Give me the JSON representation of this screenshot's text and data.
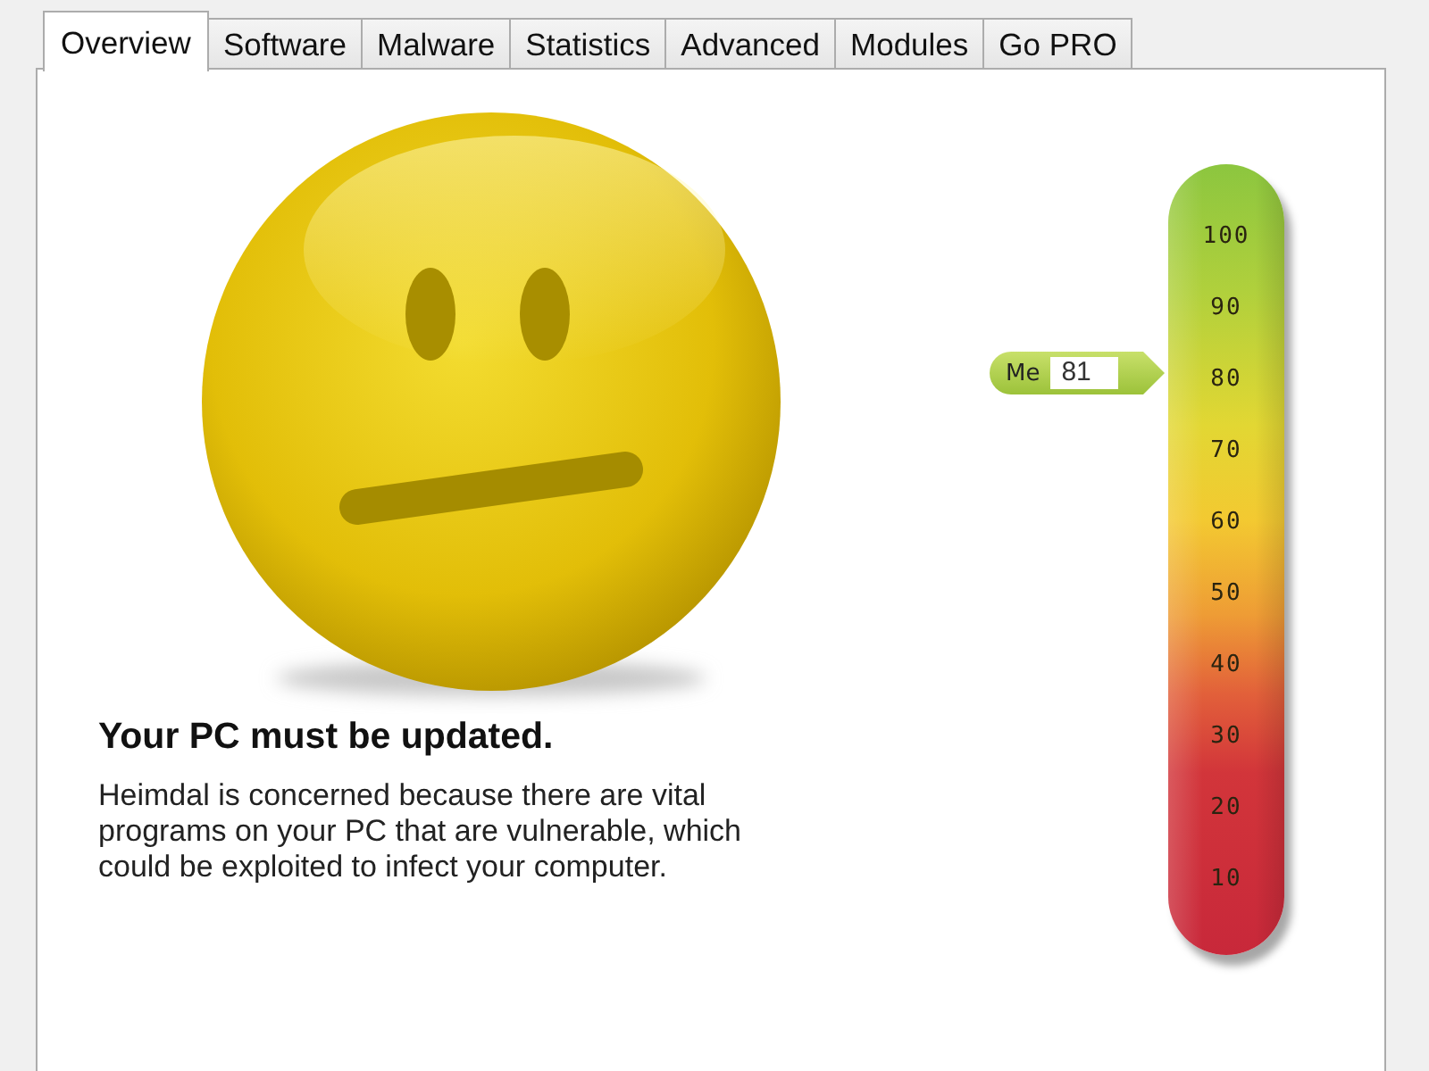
{
  "tabs": [
    {
      "label": "Overview",
      "selected": true
    },
    {
      "label": "Software",
      "selected": false
    },
    {
      "label": "Malware",
      "selected": false
    },
    {
      "label": "Statistics",
      "selected": false
    },
    {
      "label": "Advanced",
      "selected": false
    },
    {
      "label": "Modules",
      "selected": false
    },
    {
      "label": "Go PRO",
      "selected": false
    }
  ],
  "message": {
    "heading": "Your PC must be updated.",
    "body": "Heimdal is concerned because there are vital programs on your PC that are vulnerable, which could be exploited to infect your computer."
  },
  "gauge": {
    "ticks": [
      "100",
      "90",
      "80",
      "70",
      "60",
      "50",
      "40",
      "30",
      "20",
      "10"
    ],
    "marker": {
      "label": "Me",
      "reading": "81",
      "level": 0.81
    }
  }
}
